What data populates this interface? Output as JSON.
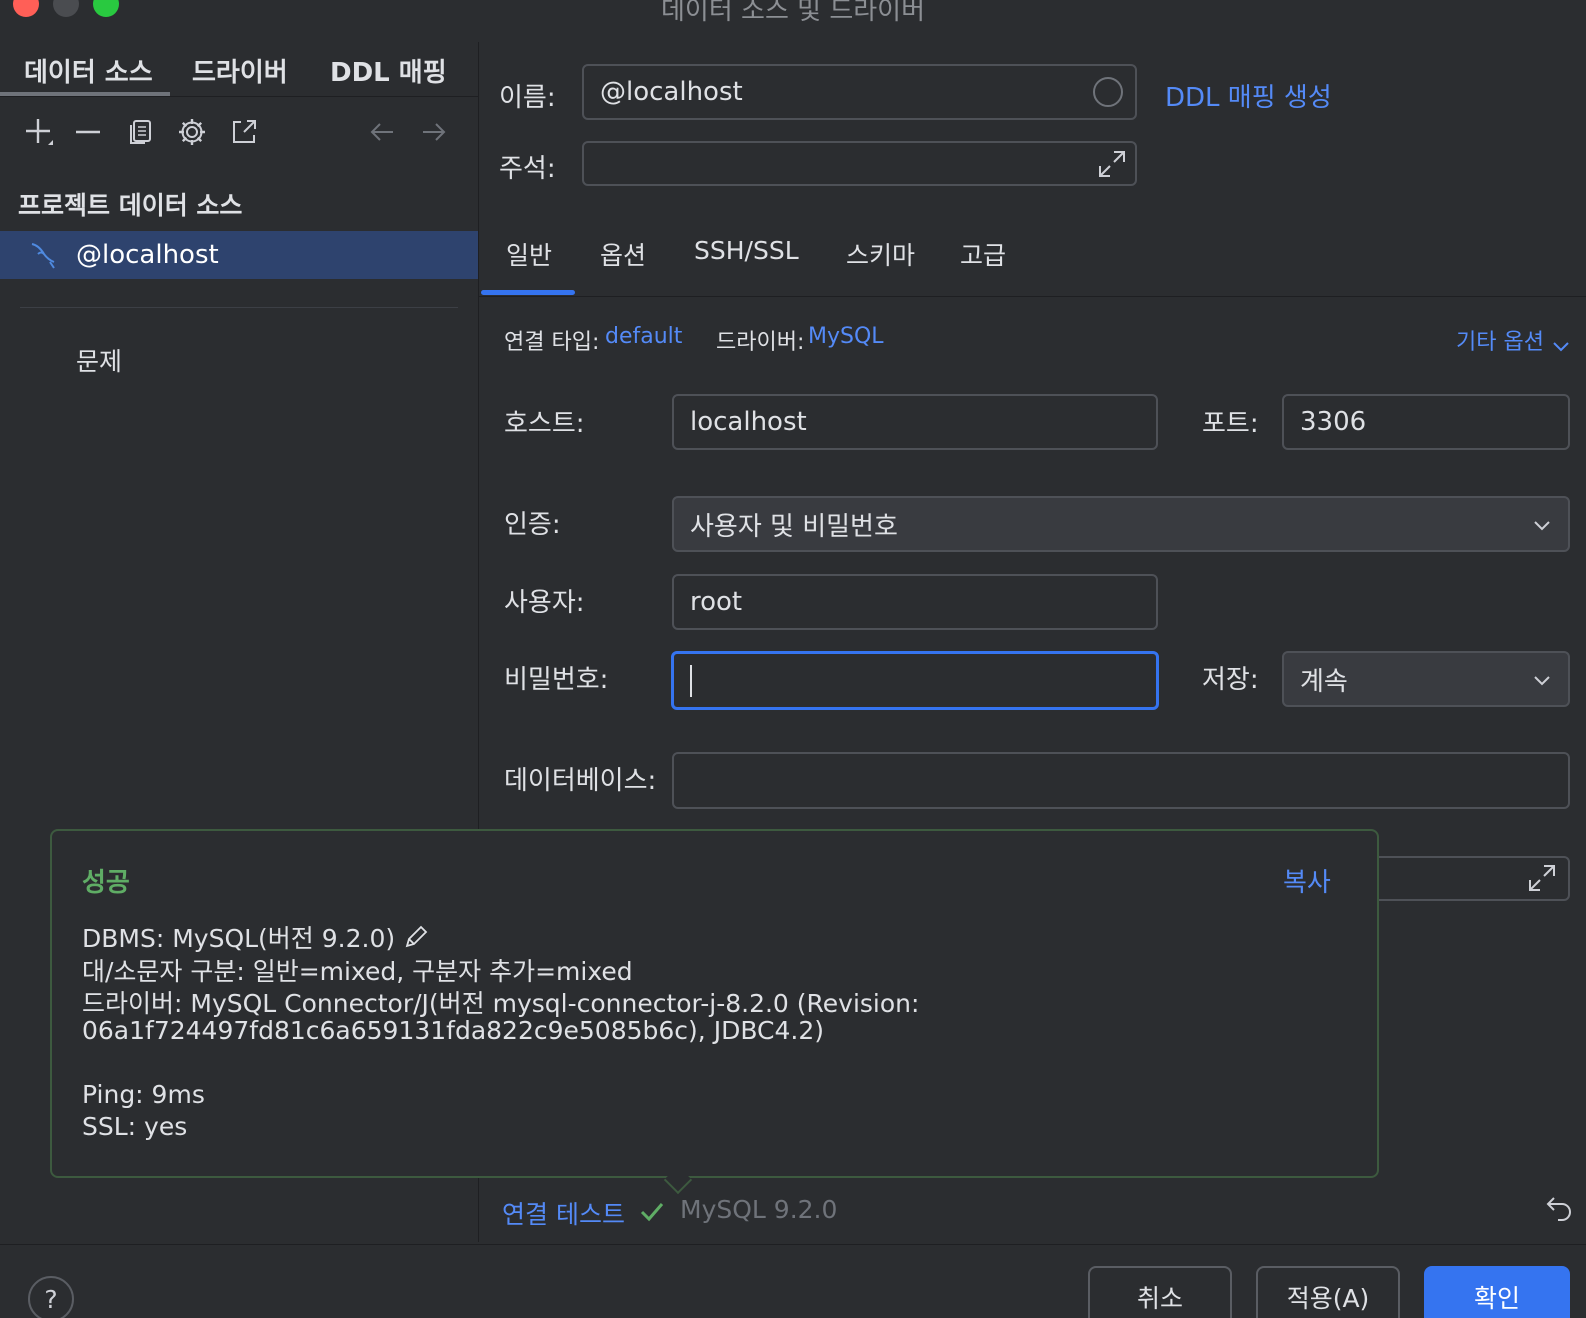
{
  "window": {
    "title": "데이터 소스 및 드라이버"
  },
  "sidebar": {
    "tabs": [
      "데이터 소스",
      "드라이버",
      "DDL 매핑"
    ],
    "section_header": "프로젝트 데이터 소스",
    "items": [
      {
        "label": "@localhost",
        "icon": "mysql-dolphin-icon"
      }
    ],
    "problems_label": "문제"
  },
  "form": {
    "name_label": "이름:",
    "name_value": "@localhost",
    "ddl_mapping_link": "DDL 매핑 생성",
    "comment_label": "주석:",
    "comment_value": "",
    "tabs": [
      "일반",
      "옵션",
      "SSH/SSL",
      "스키마",
      "고급"
    ],
    "connection_type_label": "연결 타입:",
    "connection_type_value": "default",
    "driver_label": "드라이버:",
    "driver_value": "MySQL",
    "more_options": "기타 옵션",
    "host_label": "호스트:",
    "host_value": "localhost",
    "port_label": "포트:",
    "port_value": "3306",
    "auth_label": "인증:",
    "auth_value": "사용자 및 비밀번호",
    "user_label": "사용자:",
    "user_value": "root",
    "password_label": "비밀번호:",
    "password_value": "",
    "save_label": "저장:",
    "save_value": "계속",
    "database_label": "데이터베이스:",
    "database_value": ""
  },
  "popup": {
    "title": "성공",
    "copy": "복사",
    "dbms": "DBMS: MySQL(버전 9.2.0)",
    "case": "대/소문자 구분: 일반=mixed, 구분자 추가=mixed",
    "driver_line1": "드라이버: MySQL Connector/J(버전 mysql-connector-j-8.2.0 (Revision:",
    "driver_line2": "06a1f724497fd81c6a659131fda822c9e5085b6c), JDBC4.2)",
    "ping": "Ping: 9ms",
    "ssl": "SSL: yes"
  },
  "status": {
    "test_connection": "연결 테스트",
    "version": "MySQL 9.2.0"
  },
  "buttons": {
    "help": "?",
    "cancel": "취소",
    "apply": "적용(A)",
    "ok": "확인"
  },
  "colors": {
    "accent": "#3574f0",
    "link": "#548af7",
    "success": "#5fad65",
    "background": "#2b2d30",
    "selection": "#2e436e"
  }
}
